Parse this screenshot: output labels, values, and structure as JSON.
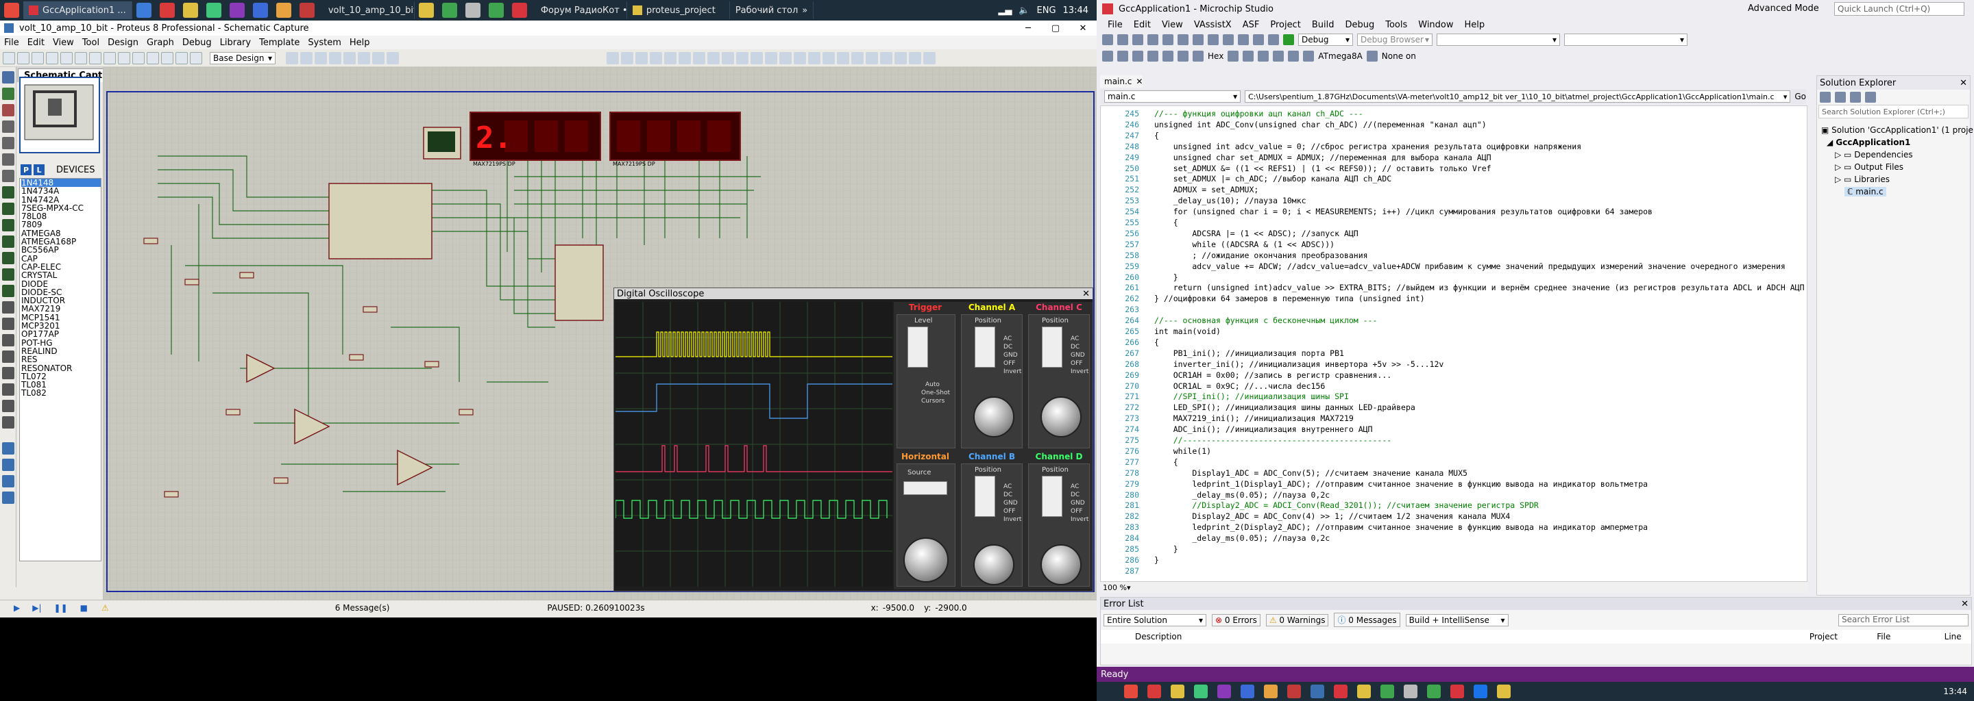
{
  "taskbar": {
    "buttons": [
      "GccApplication1 ...",
      "volt_10_amp_10_bit...",
      "Форум РадиоКот • ...",
      "proteus_project",
      "Рабочий стол"
    ],
    "lang": "ENG",
    "time": "13:44"
  },
  "proteus": {
    "title": "volt_10_amp_10_bit - Proteus 8 Professional - Schematic Capture",
    "menu": [
      "File",
      "Edit",
      "View",
      "Tool",
      "Design",
      "Graph",
      "Debug",
      "Library",
      "Template",
      "System",
      "Help"
    ],
    "design_combo": "Base Design",
    "tab": "Schematic Capture",
    "devices_label": "DEVICES",
    "devices": [
      "1N4148",
      "1N4734A",
      "1N4742A",
      "7SEG-MPX4-CC",
      "78L08",
      "7809",
      "ATMEGA8",
      "ATMEGA168P",
      "BC556AP",
      "CAP",
      "CAP-ELEC",
      "CRYSTAL",
      "DIODE",
      "DIODE-SC",
      "INDUCTOR",
      "MAX7219",
      "MCP1541",
      "MCP3201",
      "OP177AP",
      "POT-HG",
      "REALIND",
      "RES",
      "RESONATOR",
      "TL072",
      "TL081",
      "TL082"
    ],
    "selected_device": "1N4148",
    "status": {
      "messages": "6 Message(s)",
      "paused": "PAUSED: 0.260910023s",
      "x": "x:",
      "x_val": "-9500.0",
      "y": "y:",
      "y_val": "-2900.0"
    },
    "display1": "2.",
    "display1_label": "MAX7219PS DP",
    "display2_label": "MAX7219PS DP"
  },
  "oscilloscope": {
    "title": "Digital Oscilloscope",
    "trigger_label": "Trigger",
    "horizontal_label": "Horizontal",
    "channels": [
      {
        "name": "Channel A",
        "color": "#ffff00"
      },
      {
        "name": "Channel B",
        "color": "#4fa8ff"
      },
      {
        "name": "Channel C",
        "color": "#ff3b6b"
      },
      {
        "name": "Channel D",
        "color": "#3aff6a"
      }
    ],
    "labels": {
      "position": "Position",
      "level": "Level",
      "ac": "AC",
      "dc": "DC",
      "gnd": "GND",
      "off": "OFF",
      "invert": "Invert",
      "auto": "Auto",
      "one_shot": "One-Shot",
      "cursors": "Cursors",
      "source": "Source"
    }
  },
  "studio": {
    "title": "GccApplication1 - Microchip Studio",
    "advanced_mode": "Advanced Mode",
    "quick_launch": "Quick Launch (Ctrl+Q)",
    "menu": [
      "File",
      "Edit",
      "View",
      "VAssistX",
      "ASF",
      "Project",
      "Build",
      "Debug",
      "Tools",
      "Window",
      "Help"
    ],
    "config": "Debug",
    "debug_browser": "Debug Browser",
    "device": "ATmega8A",
    "tool": "None on",
    "doc_tab": "main.c",
    "file_combo": "main.c",
    "path": "C:\\Users\\pentium_1.87GHz\\Documents\\VA-meter\\volt10_amp12_bit ver_1\\10_10_bit\\atmel_project\\GccApplication1\\GccApplication1\\main.c",
    "go": "Go",
    "zoom": "100 %",
    "code_lines": [
      {
        "n": "245",
        "t": "//--- функция оцифровки ацп канал ch_ADC ---"
      },
      {
        "n": "246",
        "t": "unsigned int ADC_Conv(unsigned char ch_ADC) //(переменная \"канал ацп\")"
      },
      {
        "n": "247",
        "t": "{"
      },
      {
        "n": "248",
        "t": "    unsigned int adcv_value = 0; //сброс регистра хранения результата оцифровки напряжения"
      },
      {
        "n": "249",
        "t": "    unsigned char set_ADMUX = ADMUX; //переменная для выбора канала АЦП"
      },
      {
        "n": "250",
        "t": "    set_ADMUX &= ((1 << REFS1) | (1 << REFS0)); // оставить только Vref"
      },
      {
        "n": "251",
        "t": "    set_ADMUX |= ch_ADC; //выбор канала АЦП ch_ADC"
      },
      {
        "n": "252",
        "t": "    ADMUX = set_ADMUX;"
      },
      {
        "n": "253",
        "t": "    _delay_us(10); //пауза 10мкс"
      },
      {
        "n": "254",
        "t": "    for (unsigned char i = 0; i < MEASUREMENTS; i++) //цикл суммирования результатов оцифровки 64 замеров"
      },
      {
        "n": "255",
        "t": "    {"
      },
      {
        "n": "256",
        "t": "        ADCSRA |= (1 << ADSC); //запуск АЦП"
      },
      {
        "n": "257",
        "t": "        while ((ADCSRA & (1 << ADSC)))"
      },
      {
        "n": "258",
        "t": "        ; //ожидание окончания преобразования"
      },
      {
        "n": "259",
        "t": "        adcv_value += ADCW; //adcv_value=adcv_value+ADCW прибавим к сумме значений предыдущих измерений значение очередного измерения"
      },
      {
        "n": "260",
        "t": "    }"
      },
      {
        "n": "261",
        "t": "    return (unsigned int)adcv_value >> EXTRA_BITS; //выйдем из функции и вернём среднее значение (из регистров результата ADCL и ADCH АЦП"
      },
      {
        "n": "262",
        "t": "} //оцифровки 64 замеров в переменную типа (unsigned int)"
      },
      {
        "n": "263",
        "t": ""
      },
      {
        "n": "264",
        "t": "//--- основная функция с бесконечным циклом ---"
      },
      {
        "n": "265",
        "t": "int main(void)"
      },
      {
        "n": "266",
        "t": "{"
      },
      {
        "n": "267",
        "t": "    PB1_ini(); //инициализация порта PB1"
      },
      {
        "n": "268",
        "t": "    inverter_ini(); //инициализация инвертора +5v >> -5...12v"
      },
      {
        "n": "269",
        "t": "    OCR1AH = 0x00; //запись в регистр сравнения..."
      },
      {
        "n": "270",
        "t": "    OCR1AL = 0x9C; //...числа dec156"
      },
      {
        "n": "271",
        "t": "    //SPI_ini(); //инициализация шины SPI"
      },
      {
        "n": "272",
        "t": "    LED_SPI(); //инициализация шины данных LED-драйвера"
      },
      {
        "n": "273",
        "t": "    MAX7219_ini(); //инициализация MAX7219"
      },
      {
        "n": "274",
        "t": "    ADC_ini(); //инициализация внутреннего АЦП"
      },
      {
        "n": "275",
        "t": "    //--------------------------------------------"
      },
      {
        "n": "276",
        "t": "    while(1)"
      },
      {
        "n": "277",
        "t": "    {"
      },
      {
        "n": "278",
        "t": "        Display1_ADC = ADC_Conv(5); //считаем значение канала MUX5"
      },
      {
        "n": "279",
        "t": "        ledprint_1(Display1_ADC); //отправим считанное значение в функцию вывода на индикатор вольтметра"
      },
      {
        "n": "280",
        "t": "        _delay_ms(0.05); //пауза 0,2с"
      },
      {
        "n": "281",
        "t": "        //Display2_ADC = ADCI_Conv(Read_3201()); //считаем значение регистра SPDR"
      },
      {
        "n": "282",
        "t": "        Display2_ADC = ADC_Conv(4) >> 1; //считаем 1/2 значения канала MUX4"
      },
      {
        "n": "283",
        "t": "        ledprint_2(Display2_ADC); //отправим считанное значение в функцию вывода на индикатор амперметра"
      },
      {
        "n": "284",
        "t": "        _delay_ms(0.05); //пауза 0,2с"
      },
      {
        "n": "285",
        "t": "    }"
      },
      {
        "n": "286",
        "t": "}"
      },
      {
        "n": "287",
        "t": ""
      }
    ],
    "solution_explorer": {
      "title": "Solution Explorer",
      "search": "Search Solution Explorer (Ctrl+;)",
      "items": [
        "Solution 'GccApplication1' (1 proje",
        "GccApplication1",
        "Dependencies",
        "Output Files",
        "Libraries",
        "main.c"
      ]
    },
    "error_list": {
      "title": "Error List",
      "scope": "Entire Solution",
      "errors": "0 Errors",
      "warnings": "0 Warnings",
      "messages": "0 Messages",
      "build": "Build + IntelliSense",
      "search": "Search Error List",
      "cols": [
        "Description",
        "Project",
        "File",
        "Line"
      ]
    },
    "status": "Ready",
    "clock": "13:44"
  }
}
